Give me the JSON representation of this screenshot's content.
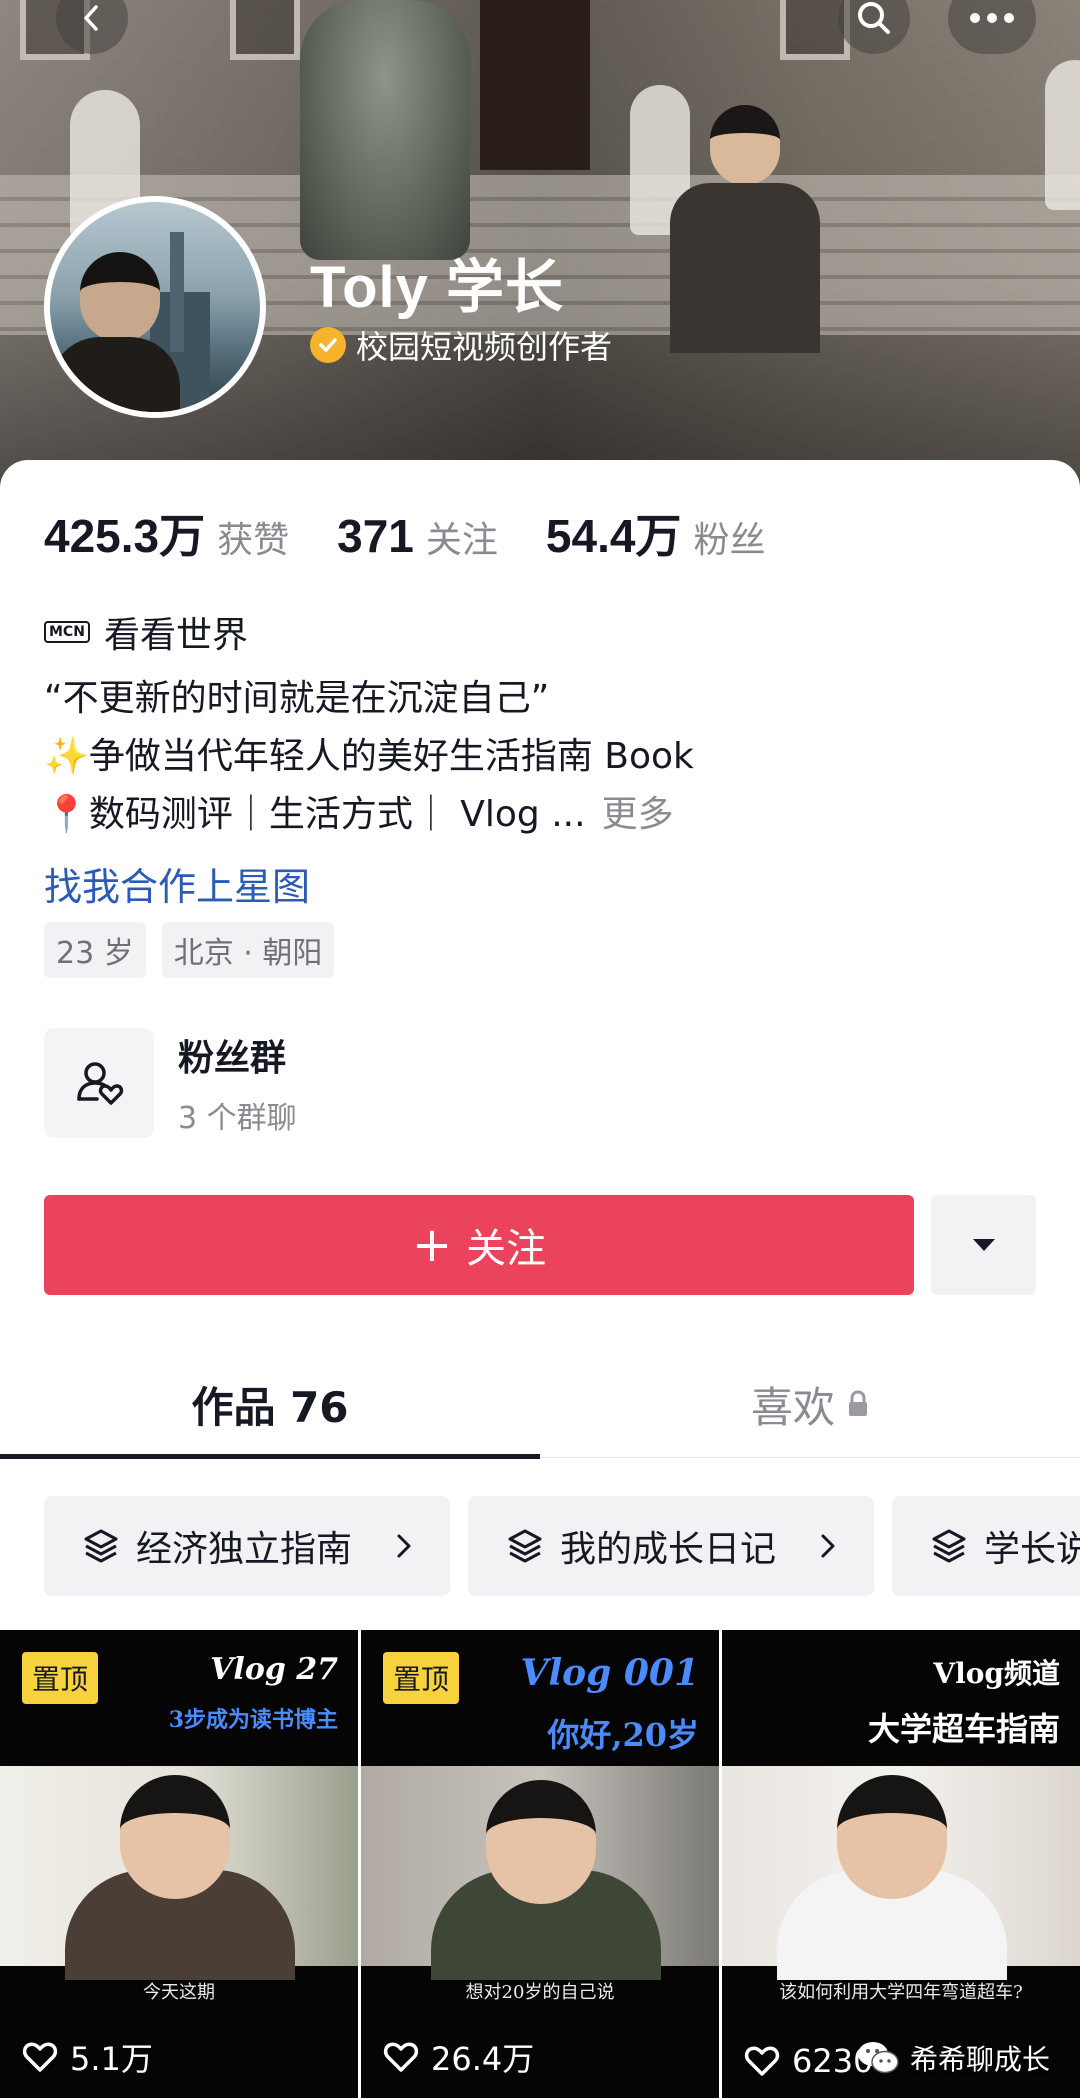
{
  "header": {
    "username": "Toly 学长",
    "verified_label": "校园短视频创作者"
  },
  "stats": [
    {
      "value": "425.3万",
      "label": "获赞"
    },
    {
      "value": "371",
      "label": "关注"
    },
    {
      "value": "54.4万",
      "label": "粉丝"
    }
  ],
  "mcn": {
    "tag": "MCN",
    "name": "看看世界"
  },
  "bio": {
    "line1": "“不更新的时间就是在沉淀自己”",
    "line2": "✨争做当代年轻人的美好生活指南 Book",
    "line3": "📍数码测评｜生活方式｜ Vlog ...",
    "more": "更多",
    "cooperation_link": "找我合作上星图"
  },
  "tags": [
    "23 岁",
    "北京 · 朝阳"
  ],
  "fan_group": {
    "title": "粉丝群",
    "subtitle": "3 个群聊"
  },
  "actions": {
    "follow_label": "关注",
    "follow_icon": "+"
  },
  "tabs": {
    "works": "作品 76",
    "likes": "喜欢"
  },
  "collections": [
    "经济独立指南",
    "我的成长日记",
    "学长说"
  ],
  "videos": [
    {
      "pin": "置顶",
      "title": "Vlog 27",
      "subtitle": "3步成为读书博主",
      "caption": "今天这期",
      "likes": "5.1万"
    },
    {
      "pin": "置顶",
      "title": "Vlog 001",
      "subtitle": "你好,20岁",
      "caption": "想对20岁的自己说",
      "likes": "26.4万"
    },
    {
      "pin": "",
      "title": "Vlog频道",
      "subtitle": "大学超车指南",
      "caption": "该如何利用大学四年弯道超车?",
      "likes": "6230"
    }
  ],
  "watermark": "希希聊成长",
  "colors": {
    "follow": "#ea435b",
    "link": "#2b5bb5",
    "pin": "#f6d33c",
    "verify": "#f5b42c"
  }
}
